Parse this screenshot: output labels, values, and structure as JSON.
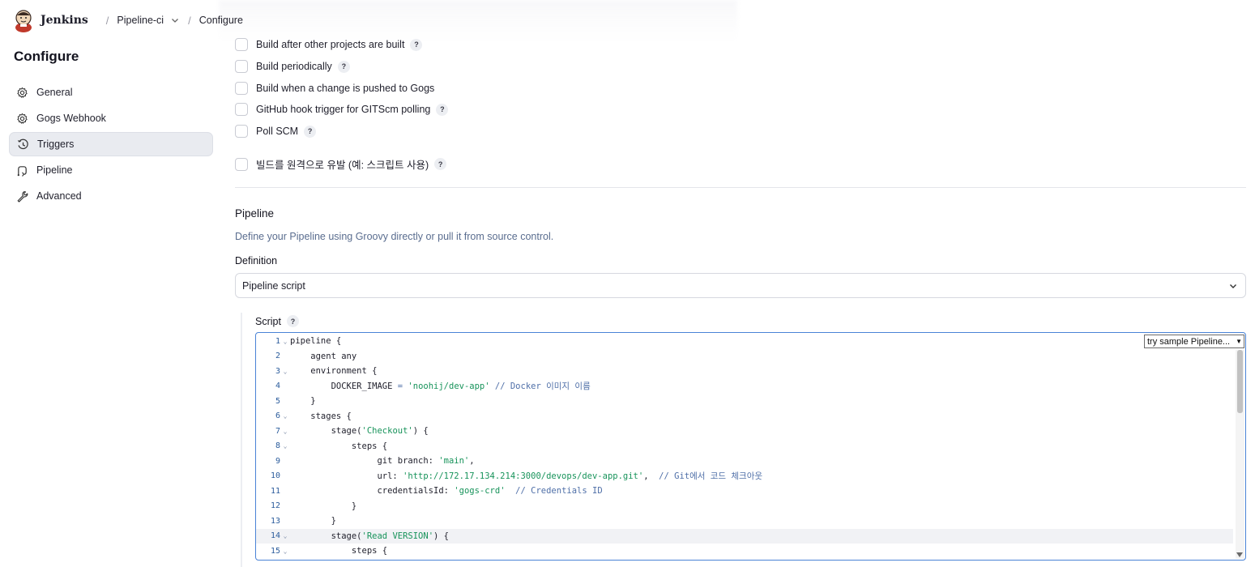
{
  "header": {
    "app_name": "Jenkins",
    "breadcrumbs": [
      {
        "label": "Pipeline-ci"
      },
      {
        "label": "Configure"
      }
    ]
  },
  "sidebar": {
    "title": "Configure",
    "items": [
      {
        "label": "General",
        "icon": "gear-icon",
        "active": false
      },
      {
        "label": "Gogs Webhook",
        "icon": "gear-icon",
        "active": false
      },
      {
        "label": "Triggers",
        "icon": "clock-icon",
        "active": true
      },
      {
        "label": "Pipeline",
        "icon": "pipeline-icon",
        "active": false
      },
      {
        "label": "Advanced",
        "icon": "wrench-icon",
        "active": false
      }
    ]
  },
  "triggers": {
    "options": [
      {
        "label": "Build after other projects are built",
        "checked": false,
        "help": "?"
      },
      {
        "label": "Build periodically",
        "checked": false,
        "help": "?"
      },
      {
        "label": "Build when a change is pushed to Gogs",
        "checked": false,
        "help": ""
      },
      {
        "label": "GitHub hook trigger for GITScm polling",
        "checked": false,
        "help": "?"
      },
      {
        "label": "Poll SCM",
        "checked": false,
        "help": "?"
      },
      {
        "label": "빌드를 원격으로 유발 (예: 스크립트 사용)",
        "checked": false,
        "help": "?"
      }
    ]
  },
  "pipeline": {
    "section_title": "Pipeline",
    "description": "Define your Pipeline using Groovy directly or pull it from source control.",
    "definition_label": "Definition",
    "definition_value": "Pipeline script",
    "script_label": "Script",
    "script_help": "?",
    "sample_select": "try sample Pipeline...",
    "lines": [
      {
        "num": "1",
        "fold": true,
        "tokens": [
          {
            "t": "pipeline {",
            "k": "code"
          }
        ]
      },
      {
        "num": "2",
        "fold": false,
        "tokens": [
          {
            "t": "    agent any",
            "k": "code"
          }
        ]
      },
      {
        "num": "3",
        "fold": true,
        "tokens": [
          {
            "t": "    environment {",
            "k": "code"
          }
        ]
      },
      {
        "num": "4",
        "fold": false,
        "tokens": [
          {
            "t": "        DOCKER_IMAGE ",
            "k": "code"
          },
          {
            "t": "=",
            "k": "op"
          },
          {
            "t": " ",
            "k": "code"
          },
          {
            "t": "'noohij/dev-app'",
            "k": "str"
          },
          {
            "t": " // Docker 이미지 이름",
            "k": "com"
          }
        ]
      },
      {
        "num": "5",
        "fold": false,
        "tokens": [
          {
            "t": "    }",
            "k": "code"
          }
        ]
      },
      {
        "num": "6",
        "fold": true,
        "tokens": [
          {
            "t": "    stages {",
            "k": "code"
          }
        ]
      },
      {
        "num": "7",
        "fold": true,
        "tokens": [
          {
            "t": "        stage(",
            "k": "code"
          },
          {
            "t": "'Checkout'",
            "k": "str"
          },
          {
            "t": ") {",
            "k": "code"
          }
        ]
      },
      {
        "num": "8",
        "fold": true,
        "tokens": [
          {
            "t": "            steps {",
            "k": "code"
          }
        ]
      },
      {
        "num": "9",
        "fold": false,
        "tokens": [
          {
            "t": "                 git branch: ",
            "k": "code"
          },
          {
            "t": "'main'",
            "k": "str"
          },
          {
            "t": ",",
            "k": "code"
          }
        ]
      },
      {
        "num": "10",
        "fold": false,
        "tokens": [
          {
            "t": "                 url: ",
            "k": "code"
          },
          {
            "t": "'http://172.17.134.214:3000/devops/dev-app.git'",
            "k": "str"
          },
          {
            "t": ",  ",
            "k": "code"
          },
          {
            "t": "// Git에서 코드 체크아웃",
            "k": "com"
          }
        ]
      },
      {
        "num": "11",
        "fold": false,
        "tokens": [
          {
            "t": "                 credentialsId: ",
            "k": "code"
          },
          {
            "t": "'gogs-crd'",
            "k": "str"
          },
          {
            "t": "  ",
            "k": "code"
          },
          {
            "t": "// Credentials ID",
            "k": "com"
          }
        ]
      },
      {
        "num": "12",
        "fold": false,
        "tokens": [
          {
            "t": "            }",
            "k": "code"
          }
        ]
      },
      {
        "num": "13",
        "fold": false,
        "tokens": [
          {
            "t": "        }",
            "k": "code"
          }
        ]
      },
      {
        "num": "14",
        "fold": true,
        "active": true,
        "tokens": [
          {
            "t": "        stage(",
            "k": "code"
          },
          {
            "t": "'Read VERSION'",
            "k": "str"
          },
          {
            "t": ") {",
            "k": "code"
          }
        ]
      },
      {
        "num": "15",
        "fold": true,
        "tokens": [
          {
            "t": "            steps {",
            "k": "code"
          }
        ]
      }
    ]
  }
}
